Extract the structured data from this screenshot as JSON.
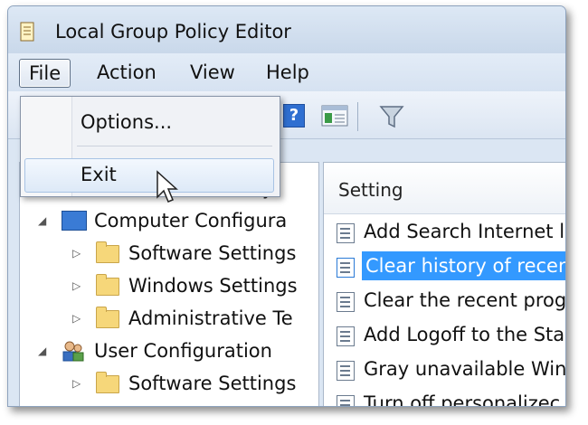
{
  "window": {
    "title": "Local Group Policy Editor"
  },
  "menubar": {
    "items": [
      "File",
      "Action",
      "View",
      "Help"
    ]
  },
  "file_menu": {
    "items": [
      "Options...",
      "Exit"
    ]
  },
  "left_pane": {
    "header_fragment": "y",
    "tree": [
      {
        "label": "Computer Configura",
        "level": 0,
        "expanded": true,
        "icon": "computer-icon"
      },
      {
        "label": "Software Settings",
        "level": 1,
        "expanded": false,
        "icon": "folder-icon"
      },
      {
        "label": "Windows Settings",
        "level": 1,
        "expanded": false,
        "icon": "folder-icon"
      },
      {
        "label": "Administrative Te",
        "level": 1,
        "expanded": false,
        "icon": "folder-icon"
      },
      {
        "label": "User Configuration",
        "level": 0,
        "expanded": true,
        "icon": "users-icon"
      },
      {
        "label": "Software Settings",
        "level": 1,
        "expanded": false,
        "icon": "folder-icon"
      }
    ]
  },
  "right_pane": {
    "column_header": "Setting",
    "rows": [
      {
        "label": "Add Search Internet l",
        "selected": false
      },
      {
        "label": "Clear history of recen",
        "selected": true
      },
      {
        "label": "Clear the recent prog",
        "selected": false
      },
      {
        "label": "Add Logoff to the Sta",
        "selected": false
      },
      {
        "label": "Gray unavailable Win",
        "selected": false
      },
      {
        "label": "Turn off personalizec",
        "selected": false
      }
    ]
  },
  "toolbar": {
    "help_glyph": "?"
  },
  "colors": {
    "selection": "#3399ff",
    "folder": "#f6d77a",
    "window_chrome": "#dbe6f3"
  }
}
